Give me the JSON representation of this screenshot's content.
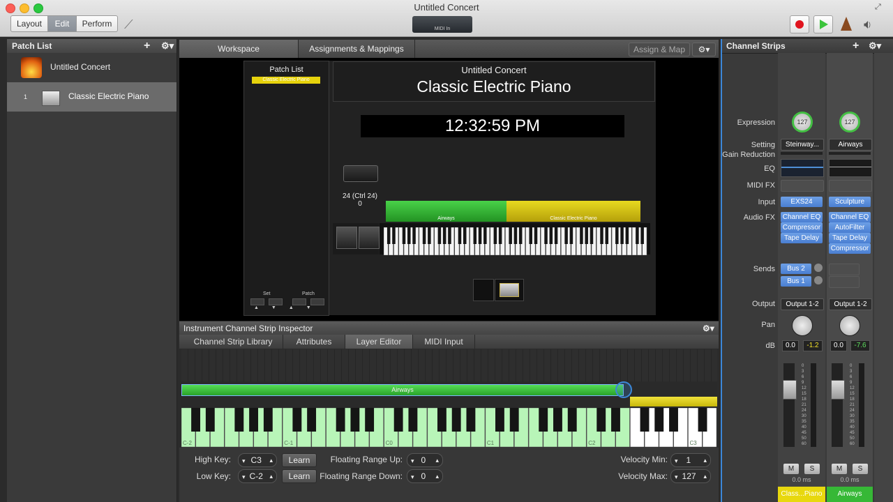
{
  "window": {
    "title": "Untitled Concert"
  },
  "toolbar": {
    "modes": [
      "Layout",
      "Edit",
      "Perform"
    ],
    "active_mode": "Edit",
    "midi_label": "MIDI In"
  },
  "patch_list": {
    "title": "Patch List",
    "concert_name": "Untitled Concert",
    "patches": [
      {
        "number": "1",
        "name": "Classic Electric Piano"
      }
    ]
  },
  "workspace": {
    "tabs": [
      "Workspace",
      "Assignments & Mappings"
    ],
    "assign_map_label": "Assign & Map",
    "patch_list_title": "Patch List",
    "patch_list_item": "Classic Electric Piano",
    "concert_name": "Untitled Concert",
    "patch_name": "Classic Electric Piano",
    "clock": "12:32:59 PM",
    "ctrl_label": "24 (Ctrl 24)",
    "ctrl_value": "0",
    "layer1": "Airways",
    "layer2": "Classic Electric Piano",
    "set_label": "Set",
    "patch_label": "Patch"
  },
  "inspector": {
    "title": "Instrument Channel Strip Inspector",
    "tabs": [
      "Channel Strip Library",
      "Attributes",
      "Layer Editor",
      "MIDI Input"
    ],
    "active_tab": "Layer Editor",
    "layer_name": "Airways",
    "octave_labels": [
      "C-2",
      "C-1",
      "C0",
      "C1",
      "C2",
      "C3"
    ],
    "high_key_label": "High Key:",
    "high_key": "C3",
    "low_key_label": "Low Key:",
    "low_key": "C-2",
    "learn_label": "Learn",
    "float_up_label": "Floating Range Up:",
    "float_up": "0",
    "float_down_label": "Floating Range Down:",
    "float_down": "0",
    "vel_min_label": "Velocity Min:",
    "vel_min": "1",
    "vel_max_label": "Velocity Max:",
    "vel_max": "127"
  },
  "channel_strips": {
    "title": "Channel Strips",
    "row_labels": {
      "expression": "Expression",
      "setting": "Setting",
      "gain": "Gain Reduction",
      "eq": "EQ",
      "midifx": "MIDI FX",
      "input": "Input",
      "audiofx": "Audio FX",
      "sends": "Sends",
      "output": "Output",
      "pan": "Pan",
      "db": "dB"
    },
    "strips": [
      {
        "expression": "127",
        "setting": "Steinway...",
        "input": "EXS24",
        "audio_fx": [
          "Channel EQ",
          "Compressor",
          "Tape Delay"
        ],
        "sends": [
          "Bus 2",
          "Bus 1"
        ],
        "output": "Output 1-2",
        "db_left": "0.0",
        "db_right": "-1.2",
        "delay": "0.0 ms",
        "name": "Class...Piano",
        "name_color": "#e8d80e"
      },
      {
        "expression": "127",
        "setting": "Airways",
        "input": "Sculpture",
        "audio_fx": [
          "Channel EQ",
          "AutoFilter",
          "Tape Delay",
          "Compressor"
        ],
        "sends": [],
        "output": "Output 1-2",
        "db_left": "0.0",
        "db_right": "-7.6",
        "delay": "0.0 ms",
        "name": "Airways",
        "name_color": "#36b836"
      }
    ],
    "meter_scale": [
      "0",
      "3",
      "6",
      "9",
      "12",
      "15",
      "18",
      "21",
      "24",
      "30",
      "35",
      "40",
      "45",
      "50",
      "60"
    ],
    "mute": "M",
    "solo": "S"
  },
  "colors": {
    "accent": "#3b87d9",
    "layer_green": "#3fbf3f",
    "layer_yellow": "#e4d40f"
  }
}
